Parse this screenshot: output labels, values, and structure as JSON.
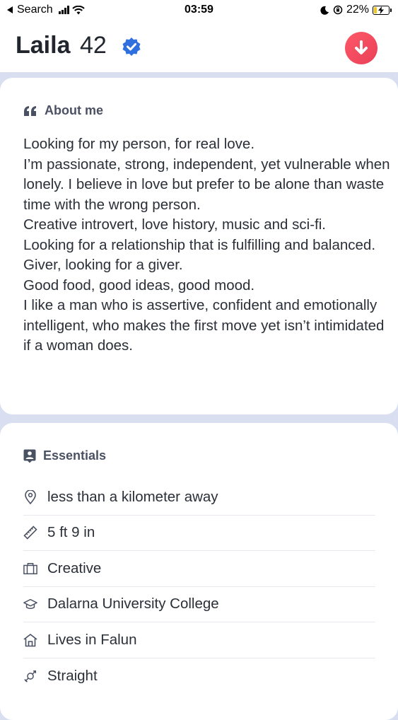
{
  "status_bar": {
    "back_label": "Search",
    "time": "03:59",
    "battery_text": "22%",
    "battery_percent": 22
  },
  "profile": {
    "name": "Laila",
    "age": "42"
  },
  "about": {
    "heading": "About me",
    "text": "Looking for my person, for real love.\nI’m passionate, strong, independent, yet vulnerable when lonely.  I believe in love but prefer to be alone than waste time with the wrong person.\nCreative introvert, love history,  music and sci-fi.\nLooking for a relationship that is fulfilling and balanced.\nGiver, looking for a giver.\nGood food, good ideas, good mood.\nI like a man who is  assertive, confident and emotionally intelligent, who makes the first move yet isn’t intimidated if a woman does."
  },
  "essentials": {
    "heading": "Essentials",
    "items": [
      {
        "icon": "location-pin-icon",
        "label": "less than a kilometer away"
      },
      {
        "icon": "ruler-icon",
        "label": "5 ft 9 in"
      },
      {
        "icon": "briefcase-icon",
        "label": "Creative"
      },
      {
        "icon": "graduation-cap-icon",
        "label": "Dalarna University College"
      },
      {
        "icon": "home-icon",
        "label": "Lives in Falun"
      },
      {
        "icon": "gender-icon",
        "label": "Straight"
      }
    ]
  },
  "colors": {
    "accent": "#fd5868",
    "verified": "#2f6fde",
    "background": "#d9dff0"
  }
}
